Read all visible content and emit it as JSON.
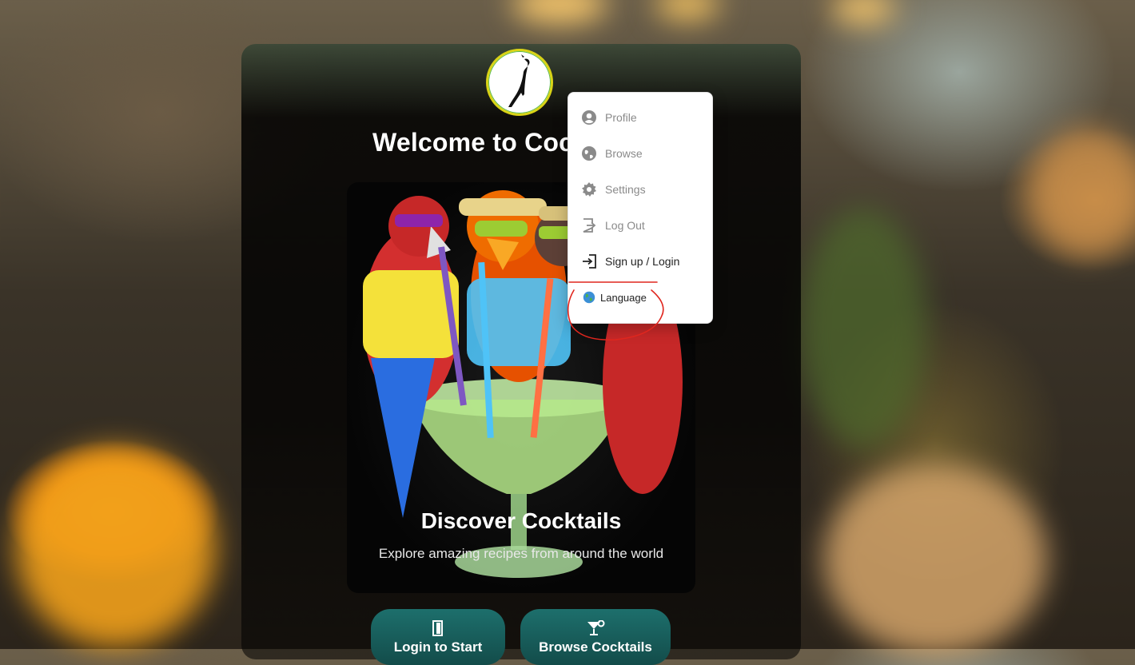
{
  "header": {
    "title": "Welcome to Cock"
  },
  "hero": {
    "title": "Discover Cocktails",
    "subtitle": "Explore amazing recipes from around the world"
  },
  "actions": [
    {
      "label": "Login to Start",
      "icon": "door-icon"
    },
    {
      "label": "Browse Cocktails",
      "icon": "cocktail-glass-icon"
    }
  ],
  "menu": {
    "items": [
      {
        "label": "Profile",
        "icon": "user-circle-icon"
      },
      {
        "label": "Browse",
        "icon": "globe-icon"
      },
      {
        "label": "Settings",
        "icon": "gear-icon"
      },
      {
        "label": "Log Out",
        "icon": "logout-icon"
      },
      {
        "label": "Sign up / Login",
        "icon": "login-icon"
      },
      {
        "label": "Language",
        "icon": "globe-emoji-icon"
      }
    ]
  },
  "colors": {
    "accent_teal": "#1d6f6c",
    "logo_ring": "#d9d316",
    "menu_disabled_text": "#8a8a8a",
    "annotation_red": "#e0261e"
  }
}
